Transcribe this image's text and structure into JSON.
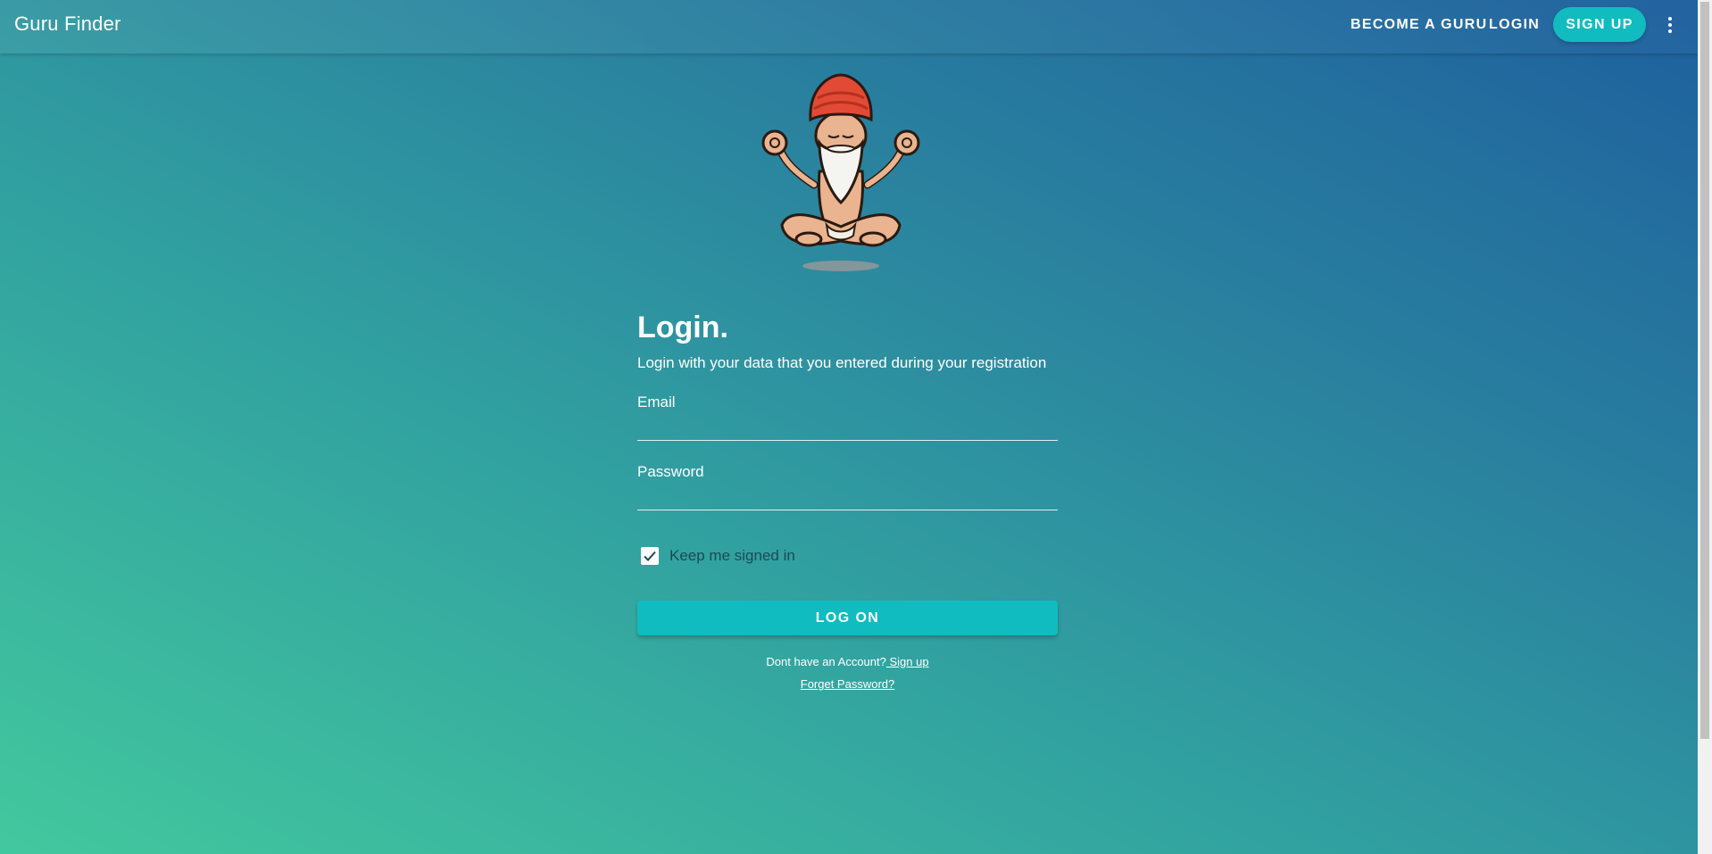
{
  "header": {
    "title": "Guru Finder",
    "become_label": "BECOME A GURU",
    "login_label": "LOGIN",
    "signup_label": "SIGN UP",
    "menu_icon": "more-vertical-icon"
  },
  "hero": {
    "illustration": "meditating-guru-illustration"
  },
  "form": {
    "heading": "Login.",
    "subtitle": "Login with your data that you entered during your registration",
    "email_label": "Email",
    "email_value": "",
    "password_label": "Password",
    "password_value": "",
    "remember_label": "Keep me signed in",
    "remember_checked": true,
    "submit_label": "LOG ON",
    "no_account_text": "Dont have an Account?",
    "signup_link": " Sign up",
    "forgot_link": "Forget Password?"
  },
  "colors": {
    "accent": "#10bcbf",
    "gradient_start": "#42c89e",
    "gradient_end": "#1e5f9e"
  }
}
